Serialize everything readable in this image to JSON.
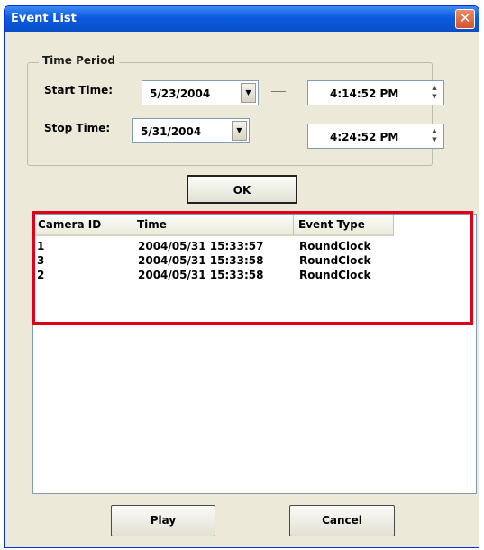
{
  "window": {
    "title": "Event List",
    "close_glyph": "✕"
  },
  "time_period": {
    "legend": "Time Period",
    "start_label": "Start Time:",
    "start_date": "5/23/2004",
    "start_time": "4:14:52 PM",
    "stop_label": "Stop Time:",
    "stop_date": "5/31/2004",
    "stop_time": "4:24:52 PM"
  },
  "ok_label": "OK",
  "event_list": {
    "columns": [
      "Camera ID",
      "Time",
      "Event Type"
    ],
    "rows": [
      {
        "camera_id": "1",
        "time": "2004/05/31 15:33:57",
        "event_type": "RoundClock"
      },
      {
        "camera_id": "3",
        "time": "2004/05/31 15:33:58",
        "event_type": "RoundClock"
      },
      {
        "camera_id": "2",
        "time": "2004/05/31 15:33:58",
        "event_type": "RoundClock"
      }
    ]
  },
  "buttons": {
    "play": "Play",
    "cancel": "Cancel"
  },
  "colors": {
    "highlight": "#e0001a",
    "titlebar": "#0a5be0"
  }
}
